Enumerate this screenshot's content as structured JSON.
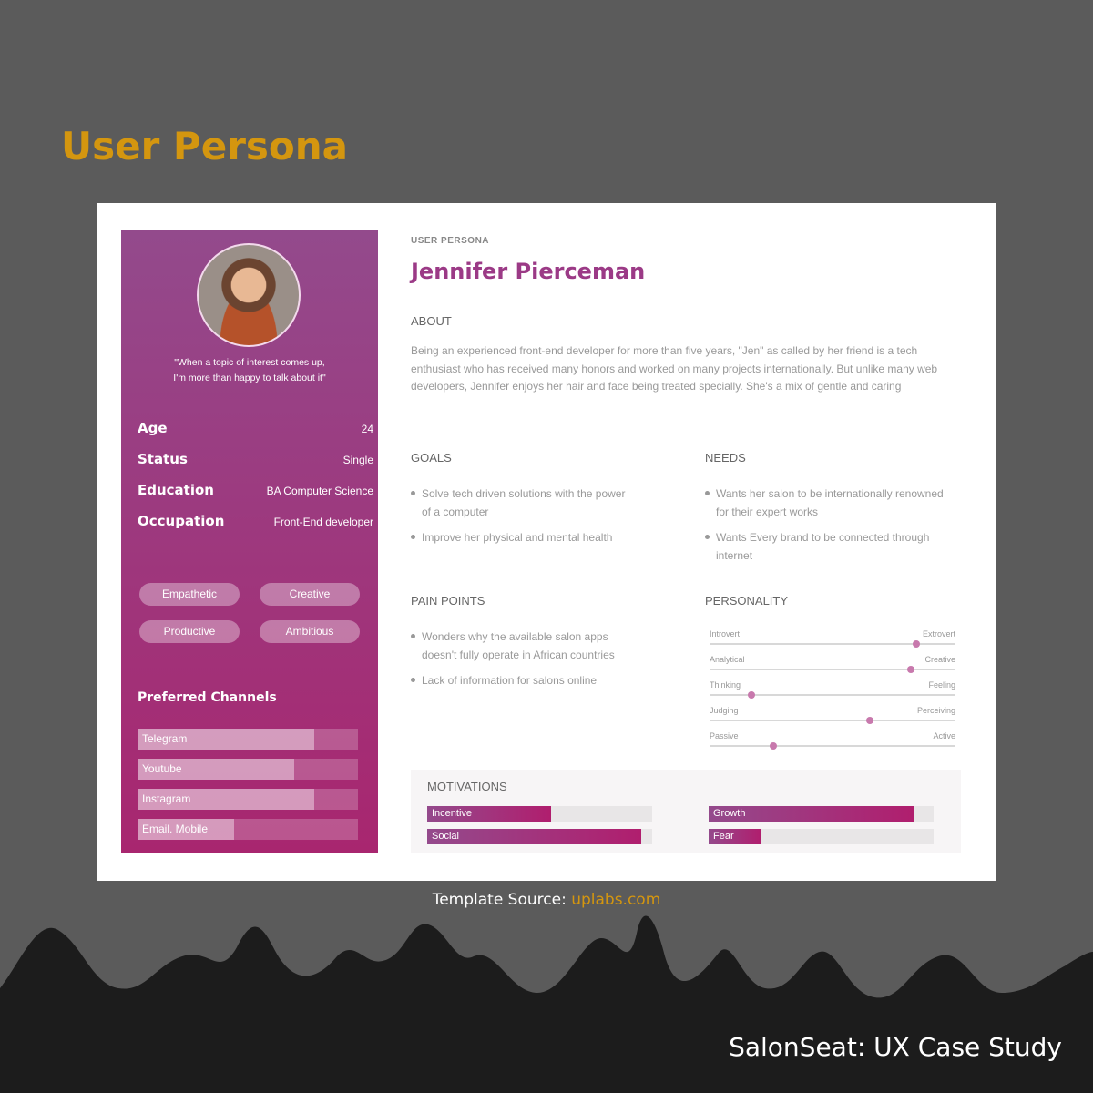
{
  "page_title": "User Persona",
  "footer": {
    "source_label": "Template Source: ",
    "source_link": "uplabs.com",
    "case_study": "SalonSeat: UX Case Study"
  },
  "colors": {
    "accent": "#d4960f",
    "brand": "#a8266f",
    "heading": "#9b3a86"
  },
  "persona": {
    "eyebrow": "USER PERSONA",
    "name": "Jennifer Pierceman",
    "quote_line1": "\"When a topic of interest comes up,",
    "quote_line2": "I'm more than happy to talk about it\"",
    "facts": [
      {
        "k": "Age",
        "v": "24"
      },
      {
        "k": "Status",
        "v": "Single"
      },
      {
        "k": "Education",
        "v": "BA Computer Science"
      },
      {
        "k": "Occupation",
        "v": "Front-End developer"
      }
    ],
    "traits": [
      "Empathetic",
      "Creative",
      "Productive",
      "Ambitious"
    ],
    "channels_title": "Preferred Channels",
    "channels": [
      {
        "label": "Telegram",
        "value": 0.8
      },
      {
        "label": "Youtube",
        "value": 0.71
      },
      {
        "label": "Instagram",
        "value": 0.8
      },
      {
        "label": "Email. Mobile",
        "value": 0.44
      }
    ],
    "about_title": "ABOUT",
    "about": "Being an experienced front-end developer for more than five years, \"Jen\" as called by her friend is a tech enthusiast who has received many honors and worked on many projects internationally. But unlike many web developers, Jennifer enjoys her hair and face being treated specially. She's a mix of gentle and caring",
    "goals_title": "GOALS",
    "goals": [
      "Solve tech driven solutions with the power of a computer",
      "Improve her physical and mental health"
    ],
    "needs_title": "NEEDS",
    "needs": [
      "Wants her salon to be internationally renowned for their expert works",
      "Wants Every brand to be connected through internet"
    ],
    "pain_title": "PAIN POINTS",
    "pain": [
      "Wonders why the available salon apps doesn't fully operate in African countries",
      "Lack of information for salons online"
    ],
    "personality_title": "PERSONALITY",
    "personality": [
      {
        "a": "Introvert",
        "b": "Extrovert",
        "value": 0.84
      },
      {
        "a": "Analytical",
        "b": "Creative",
        "value": 0.82
      },
      {
        "a": "Thinking",
        "b": "Feeling",
        "value": 0.17
      },
      {
        "a": "Judging",
        "b": "Perceiving",
        "value": 0.65
      },
      {
        "a": "Passive",
        "b": "Active",
        "value": 0.26
      }
    ],
    "motivations_title": "MOTIVATIONS",
    "motivations": [
      {
        "label": "Incentive",
        "value": 0.55
      },
      {
        "label": "Growth",
        "value": 0.91
      },
      {
        "label": "Social",
        "value": 0.95
      },
      {
        "label": "Fear",
        "value": 0.23
      }
    ]
  }
}
